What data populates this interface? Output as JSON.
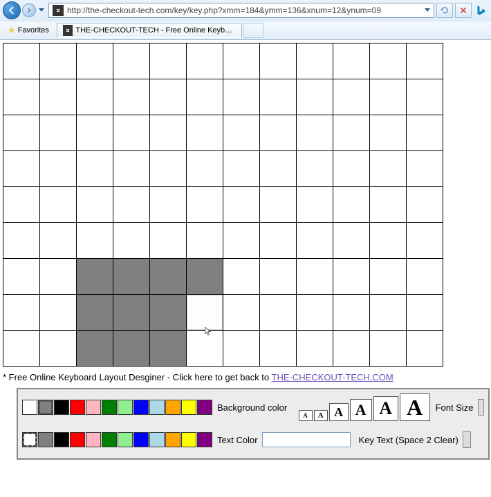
{
  "browser": {
    "url": "http://the-checkout-tech.com/key/key.php?xmm=184&ymm=136&xnum=12&ynum=09",
    "tab_title": "THE-CHECKOUT-TECH - Free Online Keyboard L...",
    "favorites_label": "Favorites"
  },
  "grid": {
    "cols": 12,
    "rows": 9,
    "selected_cells": [
      [
        6,
        2
      ],
      [
        6,
        3
      ],
      [
        6,
        4
      ],
      [
        6,
        5
      ],
      [
        7,
        2
      ],
      [
        7,
        3
      ],
      [
        7,
        4
      ],
      [
        8,
        2
      ],
      [
        8,
        3
      ],
      [
        8,
        4
      ]
    ],
    "highlight_cell": [
      7,
      5
    ]
  },
  "backlink": {
    "prefix": "* Free Online Keyboard Layout Desginer - Click here to get back to ",
    "link_text": "THE-CHECKOUT-TECH.COM"
  },
  "toolbar": {
    "bg_label": "Background color",
    "text_label": "Text Color",
    "font_label": "Font Size",
    "keytext_label": "Key Text (Space 2 Clear)",
    "colors": [
      "#ffffff",
      "#808080",
      "#000000",
      "#ff0000",
      "#ffb6c1",
      "#008000",
      "#90ee90",
      "#0000ff",
      "#add8e6",
      "#ffa500",
      "#ffff00",
      "#800080"
    ],
    "bg_active_index": 1,
    "text_active_index": 0,
    "font_glyph": "A"
  }
}
